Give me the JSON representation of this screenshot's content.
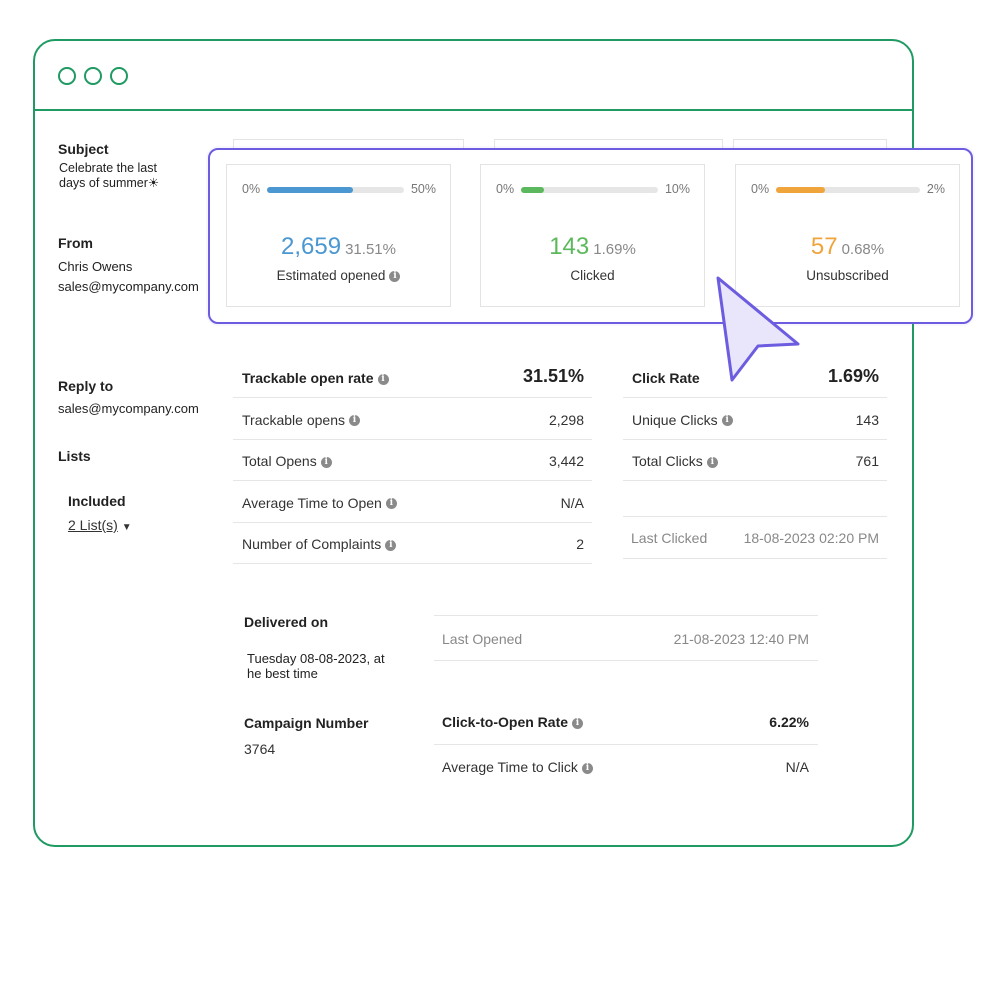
{
  "sidebar": {
    "subject_label": "Subject",
    "subject_line1": "Celebrate the last",
    "subject_line2": "days of summer☀",
    "from_label": "From",
    "from_name": "Chris Owens",
    "from_email": "sales@mycompany.com",
    "reply_label": "Reply to",
    "reply_email": "sales@mycompany.com",
    "lists_label": "Lists",
    "included_label": "Included",
    "lists_link": "2 List(s)"
  },
  "cards": [
    {
      "range_min": "0%",
      "range_max": "50%",
      "fill_fraction": 0.63,
      "color": "#4a97d1",
      "count": "2,659",
      "percent": "31.51%",
      "caption": "Estimated opened",
      "has_info": true
    },
    {
      "range_min": "0%",
      "range_max": "10%",
      "fill_fraction": 0.17,
      "color": "#5cb85c",
      "count": "143",
      "percent": "1.69%",
      "caption": "Clicked",
      "has_info": false
    },
    {
      "range_min": "0%",
      "range_max": "2%",
      "fill_fraction": 0.34,
      "color": "#f0a43c",
      "count": "57",
      "percent": "0.68%",
      "caption": "Unsubscribed",
      "has_info": false
    }
  ],
  "opens_table": {
    "header": {
      "label": "Trackable open rate",
      "value": "31.51%"
    },
    "rows": [
      {
        "label": "Trackable opens",
        "value": "2,298"
      },
      {
        "label": "Total Opens",
        "value": "3,442"
      },
      {
        "label": "Average Time to Open",
        "value": "N/A"
      },
      {
        "label": "Number of Complaints",
        "value": "2"
      }
    ]
  },
  "clicks_table": {
    "header": {
      "label": "Click Rate",
      "value": "1.69%"
    },
    "rows": [
      {
        "label": "Unique Clicks",
        "value": "143"
      },
      {
        "label": "Total Clicks",
        "value": "761"
      }
    ],
    "last_clicked_label": "Last Clicked",
    "last_clicked_value": "18-08-2023 02:20 PM"
  },
  "delivery": {
    "delivered_label": "Delivered on",
    "delivered_line1": "Tuesday 08-08-2023, at",
    "delivered_line2": "he best time",
    "campaign_label": "Campaign Number",
    "campaign_value": "3764",
    "last_opened_label": "Last Opened",
    "last_opened_value": "21-08-2023 12:40 PM",
    "cto_label": "Click-to-Open Rate",
    "cto_value": "6.22%",
    "avg_click_label": "Average Time to Click",
    "avg_click_value": "N/A"
  },
  "colors": {
    "window_border": "#1f9a62",
    "highlight": "#6c5ce0",
    "cursor_fill": "#e9e6fb"
  }
}
